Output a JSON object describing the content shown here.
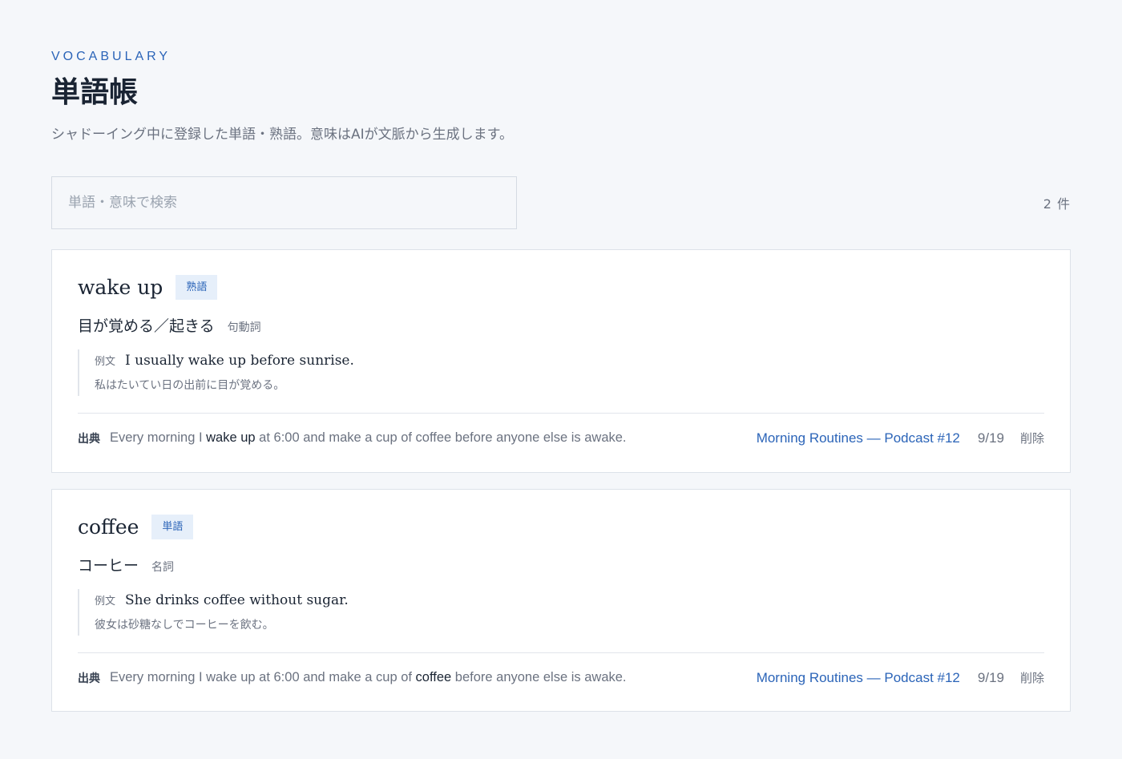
{
  "header": {
    "eyebrow": "VOCABULARY",
    "title": "単語帳",
    "subtitle": "シャドーイング中に登録した単語・熟語。意味はAIが文脈から生成します。"
  },
  "search": {
    "placeholder": "単語・意味で検索",
    "value": ""
  },
  "count_label": "2 件",
  "entries": [
    {
      "word": "wake up",
      "type_label": "熟語",
      "meaning": "目が覚める／起きる",
      "pos": "句動詞",
      "example_label": "例文",
      "example_en": "I usually wake up before sunrise.",
      "example_ja": "私はたいてい日の出前に目が覚める。",
      "source_label": "出典",
      "source_before": "Every morning I ",
      "source_highlight": "wake up",
      "source_after": " at 6:00 and make a cup of coffee before anyone else is awake.",
      "source_link": "Morning Routines — Podcast #12",
      "date": "9/19",
      "delete_label": "削除"
    },
    {
      "word": "coffee",
      "type_label": "単語",
      "meaning": "コーヒー",
      "pos": "名詞",
      "example_label": "例文",
      "example_en": "She drinks coffee without sugar.",
      "example_ja": "彼女は砂糖なしでコーヒーを飲む。",
      "source_label": "出典",
      "source_before": "Every morning I wake up at 6:00 and make a cup of ",
      "source_highlight": "coffee",
      "source_after": " before anyone else is awake.",
      "source_link": "Morning Routines — Podcast #12",
      "date": "9/19",
      "delete_label": "削除"
    }
  ]
}
